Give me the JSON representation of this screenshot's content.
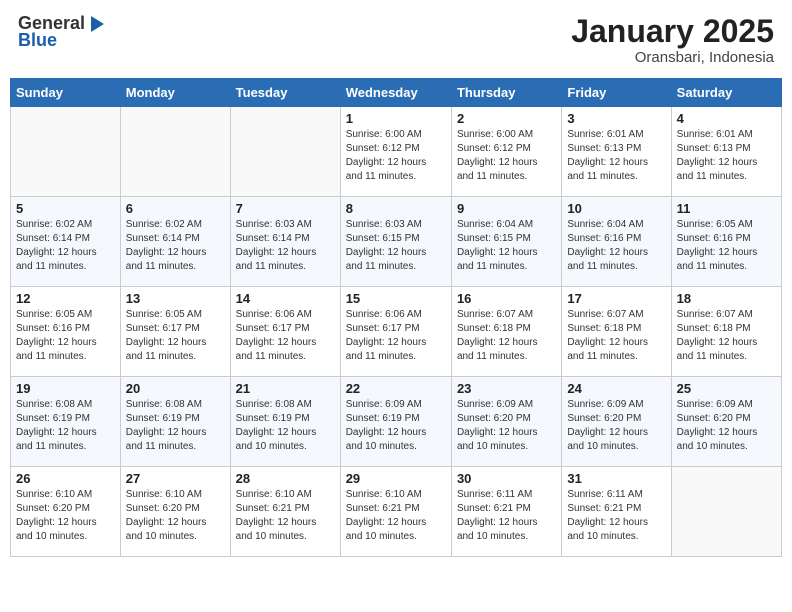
{
  "header": {
    "logo_general": "General",
    "logo_blue": "Blue",
    "month_year": "January 2025",
    "location": "Oransbari, Indonesia"
  },
  "weekdays": [
    "Sunday",
    "Monday",
    "Tuesday",
    "Wednesday",
    "Thursday",
    "Friday",
    "Saturday"
  ],
  "weeks": [
    [
      {
        "day": "",
        "info": ""
      },
      {
        "day": "",
        "info": ""
      },
      {
        "day": "",
        "info": ""
      },
      {
        "day": "1",
        "info": "Sunrise: 6:00 AM\nSunset: 6:12 PM\nDaylight: 12 hours\nand 11 minutes."
      },
      {
        "day": "2",
        "info": "Sunrise: 6:00 AM\nSunset: 6:12 PM\nDaylight: 12 hours\nand 11 minutes."
      },
      {
        "day": "3",
        "info": "Sunrise: 6:01 AM\nSunset: 6:13 PM\nDaylight: 12 hours\nand 11 minutes."
      },
      {
        "day": "4",
        "info": "Sunrise: 6:01 AM\nSunset: 6:13 PM\nDaylight: 12 hours\nand 11 minutes."
      }
    ],
    [
      {
        "day": "5",
        "info": "Sunrise: 6:02 AM\nSunset: 6:14 PM\nDaylight: 12 hours\nand 11 minutes."
      },
      {
        "day": "6",
        "info": "Sunrise: 6:02 AM\nSunset: 6:14 PM\nDaylight: 12 hours\nand 11 minutes."
      },
      {
        "day": "7",
        "info": "Sunrise: 6:03 AM\nSunset: 6:14 PM\nDaylight: 12 hours\nand 11 minutes."
      },
      {
        "day": "8",
        "info": "Sunrise: 6:03 AM\nSunset: 6:15 PM\nDaylight: 12 hours\nand 11 minutes."
      },
      {
        "day": "9",
        "info": "Sunrise: 6:04 AM\nSunset: 6:15 PM\nDaylight: 12 hours\nand 11 minutes."
      },
      {
        "day": "10",
        "info": "Sunrise: 6:04 AM\nSunset: 6:16 PM\nDaylight: 12 hours\nand 11 minutes."
      },
      {
        "day": "11",
        "info": "Sunrise: 6:05 AM\nSunset: 6:16 PM\nDaylight: 12 hours\nand 11 minutes."
      }
    ],
    [
      {
        "day": "12",
        "info": "Sunrise: 6:05 AM\nSunset: 6:16 PM\nDaylight: 12 hours\nand 11 minutes."
      },
      {
        "day": "13",
        "info": "Sunrise: 6:05 AM\nSunset: 6:17 PM\nDaylight: 12 hours\nand 11 minutes."
      },
      {
        "day": "14",
        "info": "Sunrise: 6:06 AM\nSunset: 6:17 PM\nDaylight: 12 hours\nand 11 minutes."
      },
      {
        "day": "15",
        "info": "Sunrise: 6:06 AM\nSunset: 6:17 PM\nDaylight: 12 hours\nand 11 minutes."
      },
      {
        "day": "16",
        "info": "Sunrise: 6:07 AM\nSunset: 6:18 PM\nDaylight: 12 hours\nand 11 minutes."
      },
      {
        "day": "17",
        "info": "Sunrise: 6:07 AM\nSunset: 6:18 PM\nDaylight: 12 hours\nand 11 minutes."
      },
      {
        "day": "18",
        "info": "Sunrise: 6:07 AM\nSunset: 6:18 PM\nDaylight: 12 hours\nand 11 minutes."
      }
    ],
    [
      {
        "day": "19",
        "info": "Sunrise: 6:08 AM\nSunset: 6:19 PM\nDaylight: 12 hours\nand 11 minutes."
      },
      {
        "day": "20",
        "info": "Sunrise: 6:08 AM\nSunset: 6:19 PM\nDaylight: 12 hours\nand 11 minutes."
      },
      {
        "day": "21",
        "info": "Sunrise: 6:08 AM\nSunset: 6:19 PM\nDaylight: 12 hours\nand 10 minutes."
      },
      {
        "day": "22",
        "info": "Sunrise: 6:09 AM\nSunset: 6:19 PM\nDaylight: 12 hours\nand 10 minutes."
      },
      {
        "day": "23",
        "info": "Sunrise: 6:09 AM\nSunset: 6:20 PM\nDaylight: 12 hours\nand 10 minutes."
      },
      {
        "day": "24",
        "info": "Sunrise: 6:09 AM\nSunset: 6:20 PM\nDaylight: 12 hours\nand 10 minutes."
      },
      {
        "day": "25",
        "info": "Sunrise: 6:09 AM\nSunset: 6:20 PM\nDaylight: 12 hours\nand 10 minutes."
      }
    ],
    [
      {
        "day": "26",
        "info": "Sunrise: 6:10 AM\nSunset: 6:20 PM\nDaylight: 12 hours\nand 10 minutes."
      },
      {
        "day": "27",
        "info": "Sunrise: 6:10 AM\nSunset: 6:20 PM\nDaylight: 12 hours\nand 10 minutes."
      },
      {
        "day": "28",
        "info": "Sunrise: 6:10 AM\nSunset: 6:21 PM\nDaylight: 12 hours\nand 10 minutes."
      },
      {
        "day": "29",
        "info": "Sunrise: 6:10 AM\nSunset: 6:21 PM\nDaylight: 12 hours\nand 10 minutes."
      },
      {
        "day": "30",
        "info": "Sunrise: 6:11 AM\nSunset: 6:21 PM\nDaylight: 12 hours\nand 10 minutes."
      },
      {
        "day": "31",
        "info": "Sunrise: 6:11 AM\nSunset: 6:21 PM\nDaylight: 12 hours\nand 10 minutes."
      },
      {
        "day": "",
        "info": ""
      }
    ]
  ]
}
